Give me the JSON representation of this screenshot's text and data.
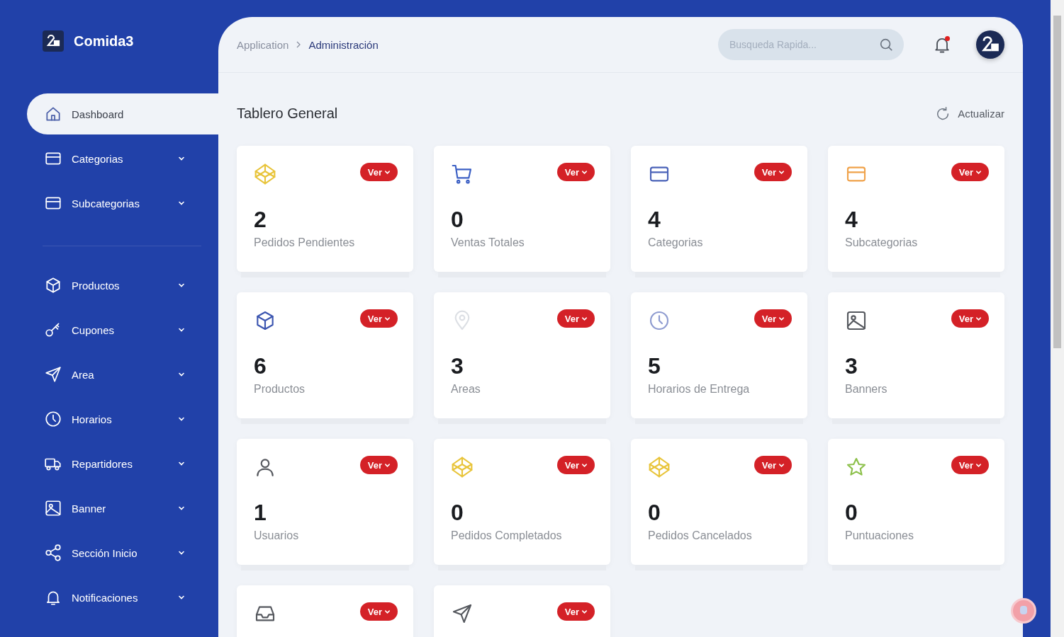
{
  "brand": {
    "name": "Comida3"
  },
  "sidebar": {
    "sections": [
      {
        "items": [
          {
            "label": "Dashboard",
            "kind": "home",
            "selected": true,
            "has_menu": false
          },
          {
            "label": "Categorias",
            "kind": "card",
            "selected": false,
            "has_menu": true
          },
          {
            "label": "Subcategorias",
            "kind": "card",
            "selected": false,
            "has_menu": true
          }
        ]
      },
      {
        "items": [
          {
            "label": "Productos",
            "kind": "cube",
            "selected": false,
            "has_menu": true
          },
          {
            "label": "Cupones",
            "kind": "key",
            "selected": false,
            "has_menu": true
          },
          {
            "label": "Area",
            "kind": "send",
            "selected": false,
            "has_menu": true
          },
          {
            "label": "Horarios",
            "kind": "clock",
            "selected": false,
            "has_menu": true
          },
          {
            "label": "Repartidores",
            "kind": "truck",
            "selected": false,
            "has_menu": true
          },
          {
            "label": "Banner",
            "kind": "image",
            "selected": false,
            "has_menu": true
          },
          {
            "label": "Sección Inicio",
            "kind": "share",
            "selected": false,
            "has_menu": true
          },
          {
            "label": "Notificaciones",
            "kind": "bell",
            "selected": false,
            "has_menu": true
          }
        ]
      }
    ]
  },
  "breadcrumb": [
    {
      "label": "Application",
      "current": false
    },
    {
      "label": "Administración",
      "current": true
    }
  ],
  "search": {
    "placeholder": "Busqueda Rapida..."
  },
  "notifications": {
    "unread": true
  },
  "page_title": "Tablero General",
  "refresh_button": "Actualizar",
  "cards": [
    {
      "kind": "codepen",
      "color": "#e8c43a",
      "badge": "Ver",
      "value": "2",
      "label": "Pedidos Pendientes"
    },
    {
      "kind": "cart",
      "color": "#3b5fc4",
      "badge": "Ver",
      "value": "0",
      "label": "Ventas Totales"
    },
    {
      "kind": "card",
      "color": "#4a62b8",
      "badge": "Ver",
      "value": "4",
      "label": "Categorias"
    },
    {
      "kind": "card",
      "color": "#f0a24a",
      "badge": "Ver",
      "value": "4",
      "label": "Subcategorias"
    },
    {
      "kind": "cube",
      "color": "#3b55b0",
      "badge": "Ver",
      "value": "6",
      "label": "Productos"
    },
    {
      "kind": "pin",
      "color": "#dcdfe4",
      "badge": "Ver",
      "value": "3",
      "label": "Areas"
    },
    {
      "kind": "clock",
      "color": "#8e9bd0",
      "badge": "Ver",
      "value": "5",
      "label": "Horarios de Entrega"
    },
    {
      "kind": "image",
      "color": "#55585e",
      "badge": "Ver",
      "value": "3",
      "label": "Banners"
    },
    {
      "kind": "user",
      "color": "#55585e",
      "badge": "Ver",
      "value": "1",
      "label": "Usuarios"
    },
    {
      "kind": "codepen",
      "color": "#e8c43a",
      "badge": "Ver",
      "value": "0",
      "label": "Pedidos Completados"
    },
    {
      "kind": "codepen",
      "color": "#e8c43a",
      "badge": "Ver",
      "value": "0",
      "label": "Pedidos Cancelados"
    },
    {
      "kind": "star",
      "color": "#8cc04a",
      "badge": "Ver",
      "value": "0",
      "label": "Puntuaciones"
    },
    {
      "kind": "inbox",
      "color": "#55585e",
      "badge": "Ver"
    },
    {
      "kind": "send",
      "color": "#55585e",
      "badge": "Ver"
    }
  ]
}
